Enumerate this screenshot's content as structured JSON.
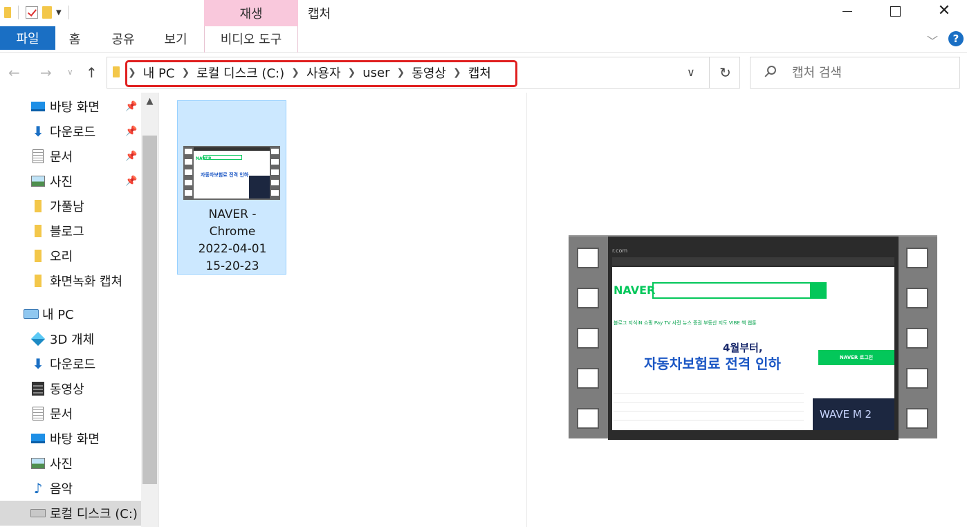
{
  "window": {
    "title": "캡처",
    "context_tab": "재생"
  },
  "ribbon": {
    "tabs": [
      "파일",
      "홈",
      "공유",
      "보기",
      "비디오 도구"
    ]
  },
  "address": {
    "crumbs": [
      "내 PC",
      "로컬 디스크 (C:)",
      "사용자",
      "user",
      "동영상",
      "캡처"
    ]
  },
  "search": {
    "placeholder": "캡처 검색"
  },
  "sidebar": {
    "items": [
      {
        "label": "바탕 화면",
        "icon": "desktop-icon",
        "pinned": true
      },
      {
        "label": "다운로드",
        "icon": "download-icon",
        "pinned": true
      },
      {
        "label": "문서",
        "icon": "document-icon",
        "pinned": true
      },
      {
        "label": "사진",
        "icon": "pictures-icon",
        "pinned": true
      },
      {
        "label": "가풀남",
        "icon": "folder-icon",
        "pinned": false
      },
      {
        "label": "블로그",
        "icon": "folder-icon",
        "pinned": false
      },
      {
        "label": "오리",
        "icon": "folder-icon",
        "pinned": false
      },
      {
        "label": "화면녹화 캡쳐",
        "icon": "folder-icon",
        "pinned": false
      },
      {
        "label": "내 PC",
        "icon": "pc-icon",
        "pinned": false
      },
      {
        "label": "3D 개체",
        "icon": "3d-objects-icon",
        "pinned": false
      },
      {
        "label": "다운로드",
        "icon": "download-icon",
        "pinned": false
      },
      {
        "label": "동영상",
        "icon": "videos-icon",
        "pinned": false
      },
      {
        "label": "문서",
        "icon": "document-icon",
        "pinned": false
      },
      {
        "label": "바탕 화면",
        "icon": "desktop-icon",
        "pinned": false
      },
      {
        "label": "사진",
        "icon": "pictures-icon",
        "pinned": false
      },
      {
        "label": "음악",
        "icon": "music-icon",
        "pinned": false
      },
      {
        "label": "로컬 디스크 (C:)",
        "icon": "disk-icon",
        "pinned": false
      }
    ]
  },
  "files": [
    {
      "name_lines": [
        "NAVER -",
        "Chrome",
        "2022-04-01",
        "15-20-23"
      ]
    }
  ],
  "thumbnail": {
    "logo": "NAVER",
    "headline": "자동차보험료 전격 인하",
    "subhead": "4월부터,",
    "login": "NAVER 로그인",
    "banner": "WAVE M 2",
    "url": "r.com",
    "menu": "블로그 지식iN 쇼핑 Pay TV 사전 뉴스 증권 부동산 지도 VIBE 책 웹툰"
  },
  "colors": {
    "accent": "#1a6fc4",
    "context_tab": "#f9c8dc",
    "selection": "#cce8ff",
    "highlight_box": "#e02020",
    "naver_green": "#03c75a"
  }
}
